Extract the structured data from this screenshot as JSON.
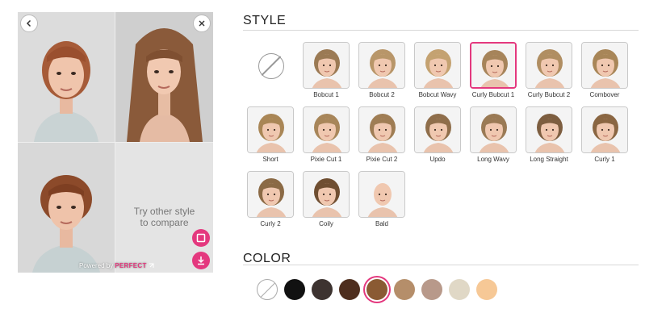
{
  "compare": {
    "hint_line1": "Try other style",
    "hint_line2": "to compare",
    "powered_prefix": "Powered by",
    "powered_brand": "PERFECT"
  },
  "style": {
    "title": "STYLE",
    "items": [
      {
        "label": "",
        "kind": "none"
      },
      {
        "label": "Bobcut 1",
        "hair": "#9b7a54"
      },
      {
        "label": "Bobcut 2",
        "hair": "#b89669"
      },
      {
        "label": "Bobcut Wavy",
        "hair": "#c4a271"
      },
      {
        "label": "Curly Bubcut 1",
        "hair": "#a6845a",
        "selected": true
      },
      {
        "label": "Curly Bubcut 2",
        "hair": "#b08e62"
      },
      {
        "label": "Combover",
        "hair": "#a88658"
      },
      {
        "label": "Short",
        "hair": "#a98656"
      },
      {
        "label": "Pixie Cut 1",
        "hair": "#a8865a"
      },
      {
        "label": "Pixie Cut 2",
        "hair": "#9f7d54"
      },
      {
        "label": "Updo",
        "hair": "#8f6e4b"
      },
      {
        "label": "Long Wavy",
        "hair": "#9a7a55"
      },
      {
        "label": "Long Straight",
        "hair": "#7d5e40"
      },
      {
        "label": "Curly 1",
        "hair": "#8a6642"
      },
      {
        "label": "Curly 2",
        "hair": "#8b6a45"
      },
      {
        "label": "Coily",
        "hair": "#6f4e31"
      },
      {
        "label": "Bald",
        "hair": "none"
      }
    ]
  },
  "color": {
    "title": "COLOR",
    "swatches": [
      {
        "name": "none",
        "hex": "#ffffff"
      },
      {
        "name": "black",
        "hex": "#111111"
      },
      {
        "name": "dark-brown",
        "hex": "#3d3330"
      },
      {
        "name": "brown",
        "hex": "#4e2e1e"
      },
      {
        "name": "medium-brown",
        "hex": "#8a5a33",
        "selected": true
      },
      {
        "name": "light-brown",
        "hex": "#b58e6a"
      },
      {
        "name": "ash-brown",
        "hex": "#b8998a"
      },
      {
        "name": "platinum",
        "hex": "#e0d8c6"
      },
      {
        "name": "blonde",
        "hex": "#f6c896"
      }
    ]
  },
  "colors": {
    "accent": "#e4387e"
  }
}
